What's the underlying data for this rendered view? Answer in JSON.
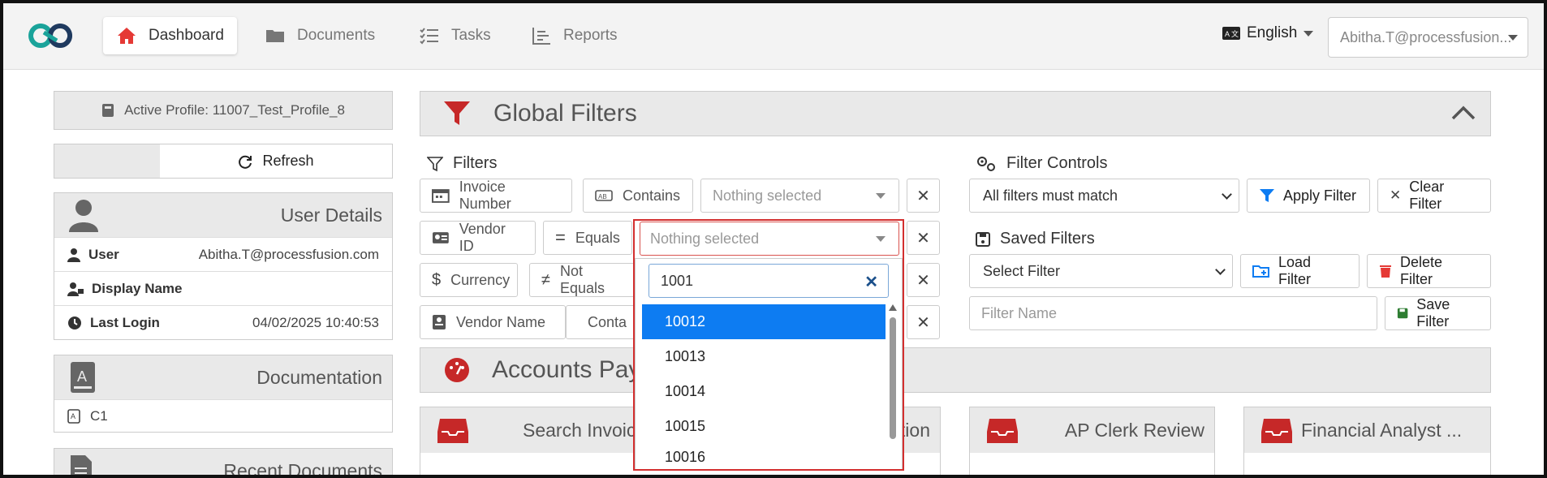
{
  "nav": {
    "items": [
      {
        "label": "Dashboard",
        "icon": "home-icon",
        "active": true
      },
      {
        "label": "Documents",
        "icon": "folder-icon"
      },
      {
        "label": "Tasks",
        "icon": "tasks-icon"
      },
      {
        "label": "Reports",
        "icon": "reports-icon"
      }
    ],
    "language": "English",
    "user_email": "Abitha.T@processfusion..."
  },
  "left": {
    "active_profile": "Active Profile: 11007_Test_Profile_8",
    "refresh_label": "Refresh",
    "user_details": {
      "title": "User Details",
      "rows": [
        {
          "key": "User",
          "value": "Abitha.T@processfusion.com"
        },
        {
          "key": "Display Name",
          "value": ""
        },
        {
          "key": "Last Login",
          "value": "04/02/2025 10:40:53"
        }
      ]
    },
    "documentation": {
      "title": "Documentation",
      "item": "C1"
    },
    "recent_documents": {
      "title": "Recent Documents"
    }
  },
  "global_filters": {
    "title": "Global Filters",
    "filters_label": "Filters",
    "rows": [
      {
        "field": "Invoice Number",
        "operator": "Contains",
        "value": "Nothing selected"
      },
      {
        "field": "Vendor ID",
        "operator": "Equals",
        "value": "Nothing selected"
      },
      {
        "field": "Currency",
        "operator": "Not Equals",
        "value": ""
      },
      {
        "field": "Vendor Name",
        "operator": "Conta",
        "value": ""
      }
    ],
    "filter_controls_label": "Filter Controls",
    "match_mode": "All filters must match",
    "apply_label": "Apply Filter",
    "clear_label": "Clear Filter",
    "saved_filters_label": "Saved Filters",
    "select_filter_placeholder": "Select Filter",
    "load_label": "Load Filter",
    "delete_label": "Delete Filter",
    "filter_name_placeholder": "Filter Name",
    "save_label": "Save Filter"
  },
  "dropdown": {
    "search_value": "1001",
    "options": [
      "10012",
      "10013",
      "10014",
      "10015",
      "10016"
    ],
    "active_index": 0
  },
  "accounts": {
    "title": "Accounts Paya",
    "cards": [
      {
        "title": "Search Invoic",
        "tail": "tion"
      },
      {
        "title": "AP Clerk Review"
      },
      {
        "title": "Financial Analyst ..."
      }
    ]
  },
  "colors": {
    "accent_red": "#d32f2f",
    "link_blue": "#0d7cf2",
    "brand_teal": "#1aa39a"
  }
}
